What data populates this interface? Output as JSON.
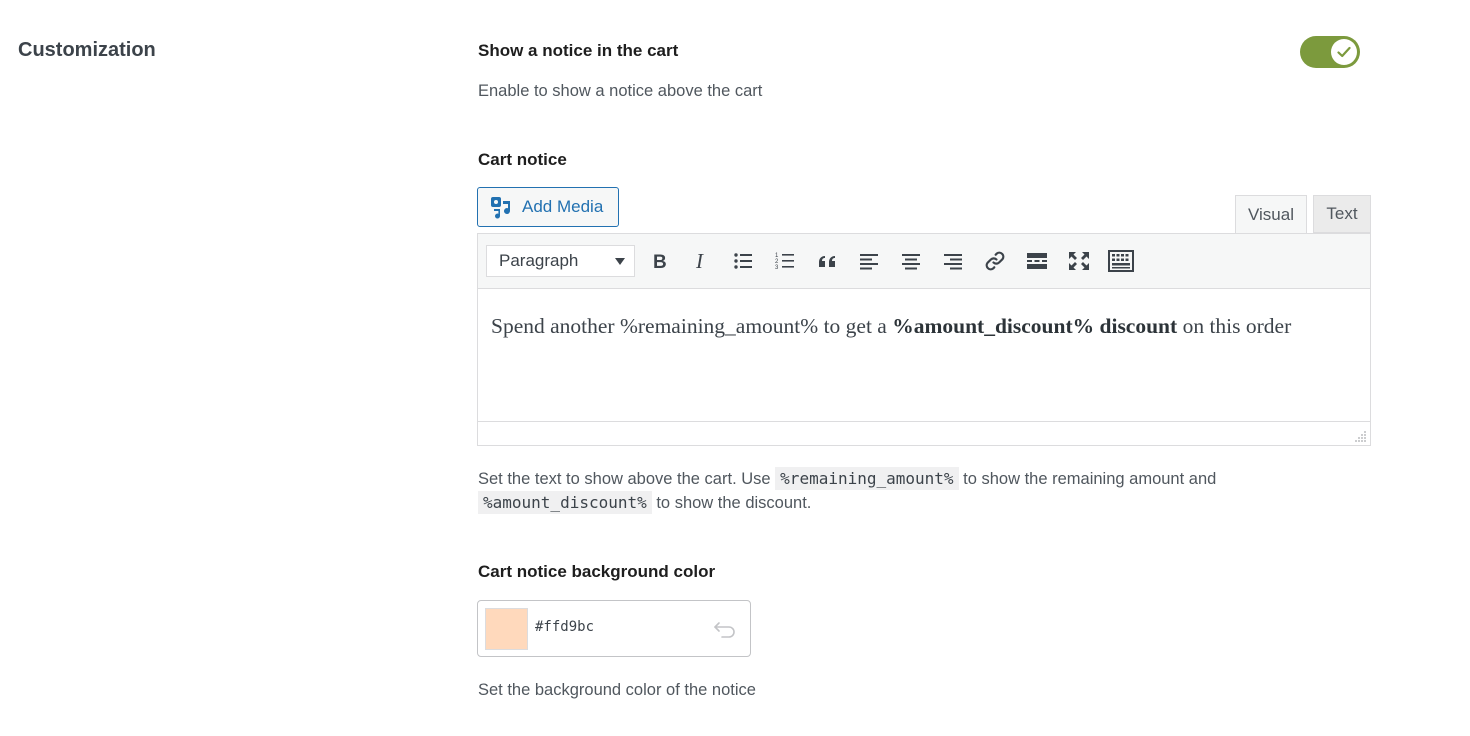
{
  "section": {
    "title": "Customization"
  },
  "show_notice": {
    "label": "Show a notice in the cart",
    "description": "Enable to show a notice above the cart",
    "enabled": true,
    "toggle_color": "#7c9a3d"
  },
  "cart_notice": {
    "label": "Cart notice",
    "add_media_label": "Add Media",
    "tabs": {
      "visual": "Visual",
      "text": "Text",
      "active": "Visual"
    },
    "format_select": "Paragraph",
    "toolbar_icons": [
      "bold-icon",
      "italic-icon",
      "bullet-list-icon",
      "numbered-list-icon",
      "blockquote-icon",
      "align-left-icon",
      "align-center-icon",
      "align-right-icon",
      "link-icon",
      "read-more-icon",
      "fullscreen-icon",
      "toolbar-toggle-icon"
    ],
    "content": {
      "part1": "Spend another %remaining_amount% to get a ",
      "bold": "%amount_discount% discount",
      "part2": " on this order"
    },
    "help": {
      "part1": "Set the text to show above the cart. Use ",
      "code1": "%remaining_amount%",
      "part2": " to show the remaining amount and",
      "code2": "%amount_discount%",
      "part3": " to show the discount."
    }
  },
  "background_color": {
    "label": "Cart notice background color",
    "value": "#ffd9bc",
    "description": "Set the background color of the notice"
  }
}
